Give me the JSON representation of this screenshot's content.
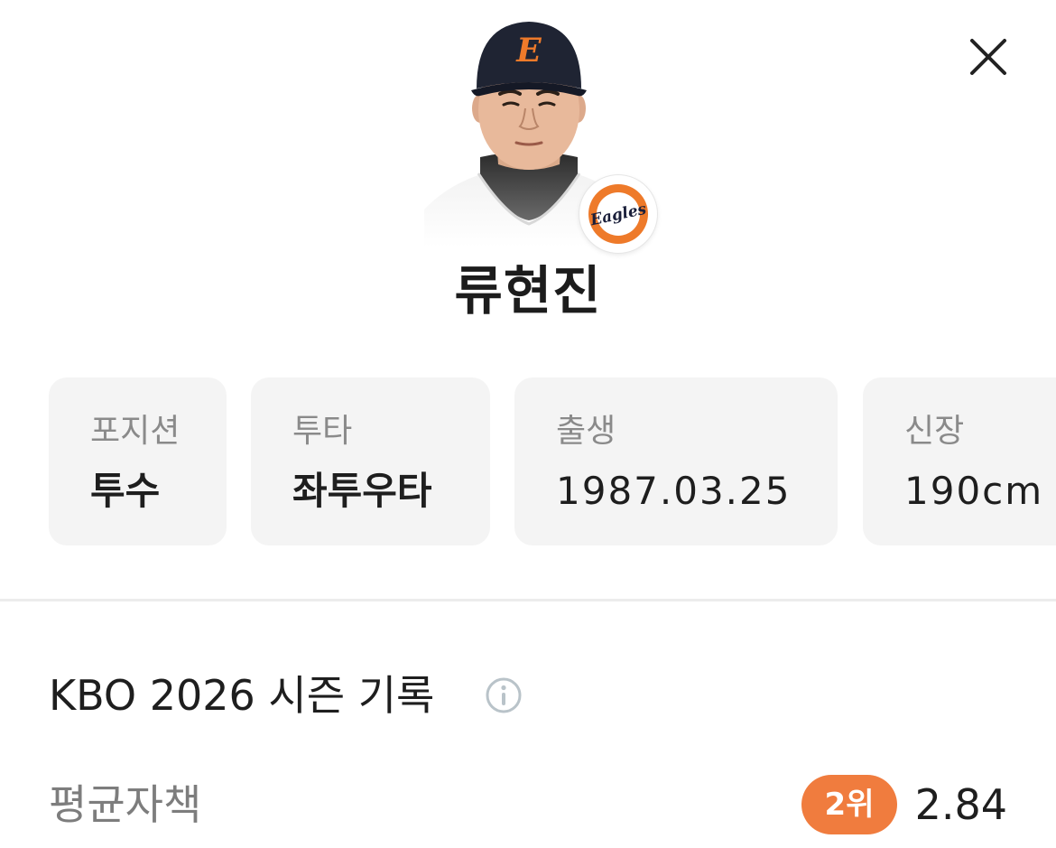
{
  "player": {
    "name": "류현진",
    "team_logo_text": "Eagles",
    "cap_letter": "E"
  },
  "profile": [
    {
      "label": "포지션",
      "value": "투수"
    },
    {
      "label": "투타",
      "value": "좌투우타"
    },
    {
      "label": "출생",
      "value": "1987.03.25"
    },
    {
      "label": "신장",
      "value": "190cm"
    }
  ],
  "season": {
    "title": "KBO 2026 시즌 기록",
    "stats": [
      {
        "label": "평균자책",
        "rank": "2위",
        "value": "2.84"
      }
    ]
  },
  "icons": {
    "close": "close-icon",
    "info": "info-icon"
  },
  "colors": {
    "accent": "#f07c3e",
    "card_bg": "#f4f4f4",
    "label_gray": "#8a8a8a"
  }
}
